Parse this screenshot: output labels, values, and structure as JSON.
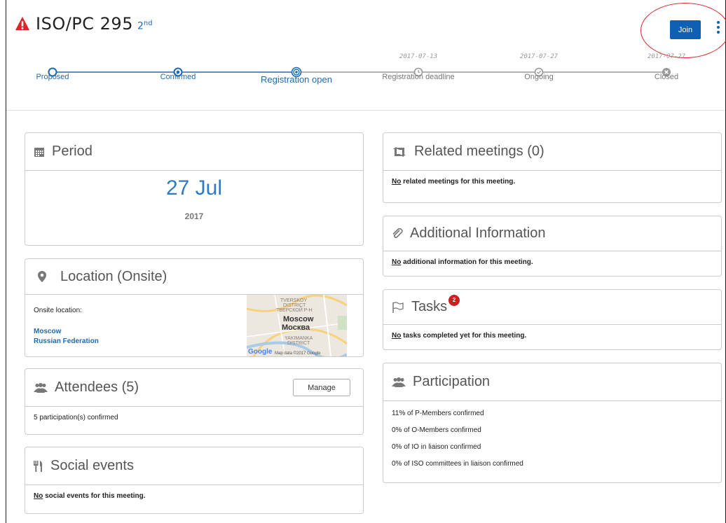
{
  "header": {
    "title": "ISO/PC 295",
    "ordinal_num": "2",
    "ordinal_suffix": "nd",
    "join_label": "Join"
  },
  "steps": [
    {
      "label": "Proposed",
      "date": "",
      "state": "done"
    },
    {
      "label": "Confirmed",
      "date": "",
      "state": "done"
    },
    {
      "label": "Registration open",
      "date": "",
      "state": "active"
    },
    {
      "label": "Registration deadline",
      "date": "2017-07-13",
      "state": "future"
    },
    {
      "label": "Ongoing",
      "date": "2017-07-27",
      "state": "future"
    },
    {
      "label": "Closed",
      "date": "2017-07-27",
      "state": "future"
    }
  ],
  "period": {
    "title": "Period",
    "day": "27 Jul",
    "year": "2017"
  },
  "location": {
    "title": "Location (Onsite)",
    "onsite_label": "Onsite location:",
    "city": "Moscow",
    "country": "Russian Federation",
    "map_labels": {
      "district": "TVERSKOY",
      "district2": "DISTRICT",
      "district_ru": "ТВЕРСКОЙ Р-Н",
      "city_en": "Moscow",
      "city_ru": "Москва",
      "yakimanka": "YAKIMANKA",
      "yak_district": "DISTRICT",
      "attribution": "Map data ©2017 Google",
      "logo": "Google"
    }
  },
  "attendees": {
    "title": "Attendees (5)",
    "manage_label": "Manage",
    "text": "5 participation(s) confirmed"
  },
  "social": {
    "title": "Social events",
    "no": "No",
    "text": " social events for this meeting."
  },
  "related": {
    "title": "Related meetings (0)",
    "no": "No",
    "text": " related meetings for this meeting."
  },
  "additional": {
    "title": "Additional Information",
    "no": "No",
    "text": " additional information for this meeting."
  },
  "tasks": {
    "title": "Tasks",
    "badge": "2",
    "no": "No",
    "text": " tasks completed yet for this meeting."
  },
  "participation": {
    "title": "Participation",
    "lines": [
      "11% of P-Members confirmed",
      "0% of O-Members confirmed",
      "0% of IO in liaison confirmed",
      "0% of ISO committees in liaison confirmed"
    ]
  },
  "colors": {
    "accent": "#1b6ab3",
    "button": "#0f5fb2",
    "warning": "#d9262c",
    "badge": "#cc1f1f"
  }
}
